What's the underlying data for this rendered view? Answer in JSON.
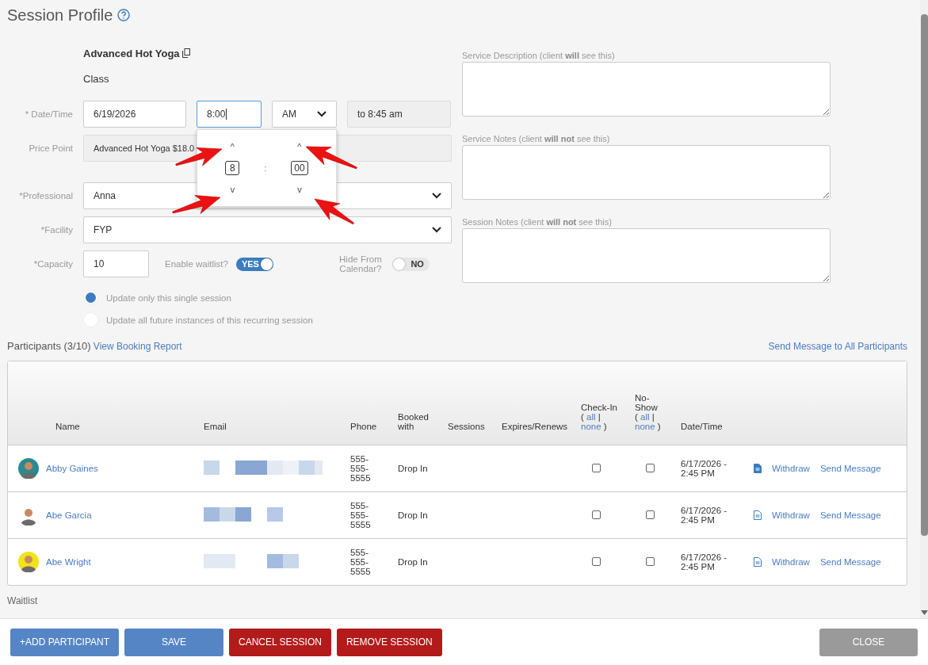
{
  "title": "Session Profile",
  "service": {
    "name": "Advanced Hot Yoga",
    "type": "Class"
  },
  "date_time": {
    "label": "* Date/Time",
    "date": "6/19/2026",
    "time": "8:00",
    "meridiem": "AM",
    "end": "to 8:45 am"
  },
  "time_picker": {
    "separator": ":",
    "columns": [
      {
        "up": "^",
        "value": "8",
        "down": "v"
      },
      {
        "up": "^",
        "value": "00",
        "down": "v"
      }
    ]
  },
  "price_point": {
    "label": "Price Point",
    "value": "Advanced Hot Yoga $18.0"
  },
  "professional": {
    "label": "*Professional",
    "value": "Anna"
  },
  "facility": {
    "label": "*Facility",
    "value": "FYP"
  },
  "capacity": {
    "label": "*Capacity",
    "value": "10"
  },
  "toggles": [
    {
      "label": "Enable waitlist?",
      "on": true,
      "text": "YES"
    },
    {
      "label": "Hide From Calendar?",
      "on": false,
      "text": "NO"
    }
  ],
  "update_scope": [
    {
      "label": "Update only this single session",
      "selected": true
    },
    {
      "label": "Update all future instances of this recurring session",
      "selected": false
    }
  ],
  "notes": [
    {
      "label": "Service Description (client **will** see this)"
    },
    {
      "label": "Service Notes (client **will not** see this)"
    },
    {
      "label": "Session Notes (client **will not** see this)"
    }
  ],
  "participants": {
    "heading": "Participants (3/10)",
    "report_link": "View Booking Report",
    "message_all": "Send Message to All Participants",
    "columns": [
      {
        "parts": [
          {
            "text": "Name"
          }
        ]
      },
      {
        "parts": [
          {
            "text": "Email"
          }
        ]
      },
      {
        "parts": [
          {
            "text": "Phone"
          }
        ]
      },
      {
        "parts": [
          {
            "text": "Booked with"
          }
        ]
      },
      {
        "parts": [
          {
            "text": "Sessions"
          }
        ]
      },
      {
        "parts": [
          {
            "text": "Expires/Renews"
          }
        ]
      },
      {
        "parts": [
          {
            "text": "Check-In"
          },
          {
            "text": "("
          },
          {
            "link": "all"
          },
          {
            "text": "|"
          },
          {
            "link": "none"
          },
          {
            "text": ")"
          }
        ]
      },
      {
        "parts": [
          {
            "text": "No-Show"
          },
          {
            "text": "("
          },
          {
            "link": "all"
          },
          {
            "text": "|"
          },
          {
            "link": "none"
          },
          {
            "text": ")"
          }
        ]
      },
      {
        "parts": [
          {
            "text": "Date/Time"
          }
        ]
      }
    ],
    "rows": [
      {
        "name": "Abby Gaines",
        "email": {
          "kind": "redacted"
        },
        "phone": "555-555-5555",
        "booked_with": "Drop In",
        "checked_in": false,
        "no_show": false,
        "date_time": "6/17/2026 - 2:45 PM",
        "doc_filled": true,
        "actions": [
          "Withdraw",
          "Send Message"
        ]
      },
      {
        "name": "Abe Garcia",
        "email": {
          "kind": "redacted"
        },
        "phone": "555-555-5555",
        "booked_with": "Drop In",
        "checked_in": false,
        "no_show": false,
        "date_time": "6/17/2026 - 2:45 PM",
        "doc_filled": false,
        "actions": [
          "Withdraw",
          "Send Message"
        ]
      },
      {
        "name": "Abe Wright",
        "email": {
          "kind": "redacted"
        },
        "phone": "555-555-5555",
        "booked_with": "Drop In",
        "checked_in": false,
        "no_show": false,
        "date_time": "6/17/2026 - 2:45 PM",
        "doc_filled": false,
        "actions": [
          "Withdraw",
          "Send Message"
        ]
      }
    ]
  },
  "waitlist_heading": "Waitlist",
  "buttons": [
    {
      "label": "+ADD PARTICIPANT",
      "kind": "primary"
    },
    {
      "label": "SAVE",
      "kind": "primary"
    },
    {
      "label": "CANCEL SESSION",
      "kind": "danger"
    },
    {
      "label": "REMOVE SESSION",
      "kind": "danger"
    },
    {
      "label": "CLOSE",
      "kind": "secondary"
    }
  ]
}
